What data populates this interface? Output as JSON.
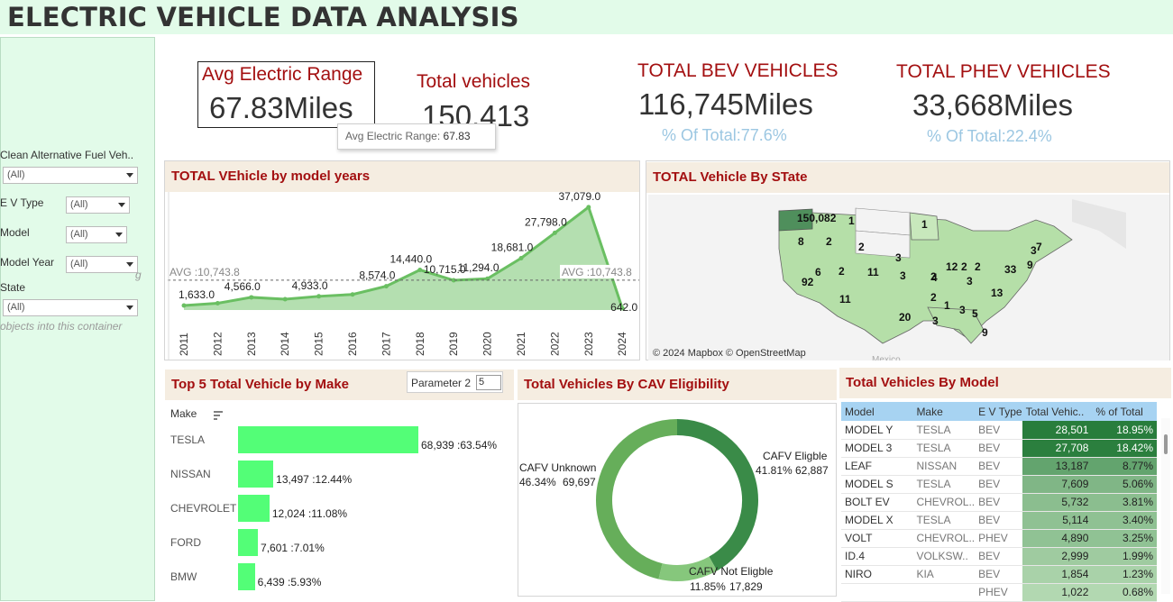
{
  "page_title": "ELECTRIC VEHICLE DATA ANALYSIS",
  "filters": {
    "clean_alt_fuel": {
      "label": "Clean Alternative Fuel Veh..",
      "value": "(All)"
    },
    "ev_type": {
      "label": "E V Type",
      "value": "(All)"
    },
    "model": {
      "label": "Model",
      "value": "(All)"
    },
    "model_year": {
      "label": "Model Year",
      "value": "(All)"
    },
    "state": {
      "label": "State",
      "value": "(All)"
    },
    "drop_hint": "objects into this container",
    "drop_hint_g": "g"
  },
  "kpis": {
    "avg_range": {
      "label": "Avg Electric Range",
      "value": "67.83Miles"
    },
    "total_vehicles": {
      "label": "Total vehicles",
      "value": "150,413"
    },
    "bev": {
      "label": "TOTAL BEV VEHICLES",
      "value": "116,745Miles",
      "pct": "% Of Total:77.6%"
    },
    "phev": {
      "label": "TOTAL PHEV VEHICLES",
      "value": "33,668Miles",
      "pct": "% Of Total:22.4%"
    }
  },
  "tooltip": {
    "label": "Avg Electric Range:",
    "value": "67.83"
  },
  "panels": {
    "years": "TOTAL VEhicle by model years",
    "state": "TOTAL Vehicle By STate",
    "make": "Top 5  Total Vehicle by Make",
    "cav": "Total Vehicles By CAV Eligibility",
    "model": "Total Vehicles By Model"
  },
  "map": {
    "credit": "© 2024 Mapbox © OpenStreetMap",
    "corner_text": "Mexico",
    "state_labels": [
      "150,082",
      "1",
      "1",
      "8",
      "2",
      "2",
      "3",
      "6",
      "2",
      "11",
      "3",
      "92",
      "2",
      "4",
      "12",
      "2",
      "2",
      "3",
      "33",
      "7",
      "3",
      "9",
      "11",
      "2",
      "1",
      "3",
      "5",
      "13",
      "20",
      "3",
      "9"
    ]
  },
  "chart_data": [
    {
      "type": "area",
      "title": "TOTAL VEhicle by model years",
      "x": [
        "2011",
        "2012",
        "2013",
        "2014",
        "2015",
        "2016",
        "2017",
        "2018",
        "2019",
        "2020",
        "2021",
        "2022",
        "2023",
        "2024"
      ],
      "values": [
        1633,
        2450,
        4566,
        3900,
        4933,
        5600,
        8574,
        14440,
        10715,
        11294,
        18681,
        27798,
        37079,
        642
      ],
      "data_labels": {
        "2011": "1,633.0",
        "2013": "4,566.0",
        "2015": "4,933.0",
        "2017": "8,574.0",
        "2018": "14,440.0",
        "2019": "10,715.0",
        "2020": "11,294.0",
        "2021": "18,681.0",
        "2022": "27,798.0",
        "2023": "37,079.0",
        "2024": "642.0"
      },
      "reference_line": {
        "value": 10743.8,
        "label": "AVG :10,743.8"
      },
      "ylim": [
        0,
        38000
      ],
      "color": "#6abf62"
    },
    {
      "type": "bar",
      "title": "Top 5  Total Vehicle by Make",
      "axis_label": "Make",
      "parameter": {
        "label": "Parameter 2",
        "value": "5"
      },
      "categories": [
        "TESLA",
        "NISSAN",
        "CHEVROLET",
        "FORD",
        "BMW"
      ],
      "values": [
        68939,
        13497,
        12024,
        7601,
        6439
      ],
      "data_labels": [
        "68,939 :63.54%",
        "13,497 :12.44%",
        "12,024 :11.08%",
        "7,601 :7.01%",
        "6,439 :5.93%"
      ],
      "color": "#53fe77"
    },
    {
      "type": "pie",
      "title": "Total Vehicles By CAV Eligibility",
      "categories": [
        "CAFV Eligble",
        "CAFV Not Eligble",
        "CAFV Unknown"
      ],
      "values": [
        62887,
        17829,
        69697
      ],
      "percent_labels": [
        "41.81%",
        "11.85%",
        "46.34%"
      ],
      "value_labels": [
        "62,887",
        "17,829",
        "69,697"
      ],
      "colors": [
        "#3a8b48",
        "#86c77c",
        "#66ae5a"
      ]
    },
    {
      "type": "table",
      "title": "Total Vehicles By Model",
      "columns": [
        "Model",
        "Make",
        "E V Type",
        "Total Vehic..",
        "% of Total"
      ],
      "rows": [
        [
          "MODEL Y",
          "TESLA",
          "BEV",
          "28,501",
          "18.95%"
        ],
        [
          "MODEL 3",
          "TESLA",
          "BEV",
          "27,708",
          "18.42%"
        ],
        [
          "LEAF",
          "NISSAN",
          "BEV",
          "13,187",
          "8.77%"
        ],
        [
          "MODEL S",
          "TESLA",
          "BEV",
          "7,609",
          "5.06%"
        ],
        [
          "BOLT EV",
          "CHEVROL..",
          "BEV",
          "5,732",
          "3.81%"
        ],
        [
          "MODEL X",
          "TESLA",
          "BEV",
          "5,114",
          "3.40%"
        ],
        [
          "VOLT",
          "CHEVROL..",
          "PHEV",
          "4,890",
          "3.25%"
        ],
        [
          "ID.4",
          "VOLKSW..",
          "BEV",
          "2,999",
          "1.99%"
        ],
        [
          "NIRO",
          "KIA",
          "BEV",
          "1,854",
          "1.23%"
        ],
        [
          "",
          "",
          "PHEV",
          "1,022",
          "0.68%"
        ]
      ],
      "heat_values": [
        28501,
        27708,
        13187,
        7609,
        5732,
        5114,
        4890,
        2999,
        1854,
        1022
      ]
    }
  ]
}
